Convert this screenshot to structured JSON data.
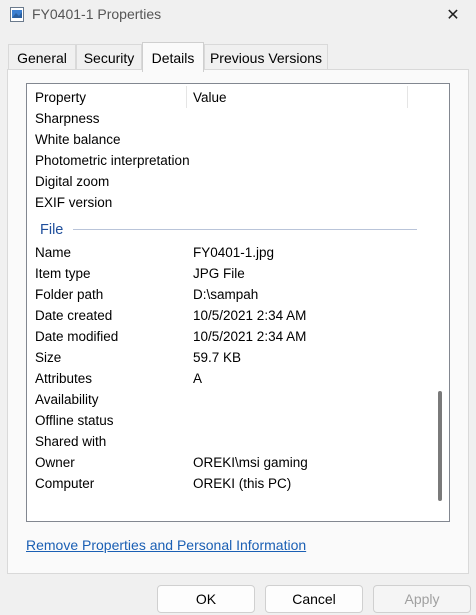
{
  "window": {
    "title": "FY0401-1 Properties",
    "close_icon": "✕"
  },
  "tabs": [
    {
      "label": "General"
    },
    {
      "label": "Security"
    },
    {
      "label": "Details"
    },
    {
      "label": "Previous Versions"
    }
  ],
  "active_tab": "Details",
  "details": {
    "column_property": "Property",
    "column_value": "Value",
    "image_rows": [
      {
        "name": "Sharpness",
        "value": ""
      },
      {
        "name": "White balance",
        "value": ""
      },
      {
        "name": "Photometric interpretation",
        "value": ""
      },
      {
        "name": "Digital zoom",
        "value": ""
      },
      {
        "name": "EXIF version",
        "value": ""
      }
    ],
    "file_group_label": "File",
    "file_rows": [
      {
        "name": "Name",
        "value": "FY0401-1.jpg"
      },
      {
        "name": "Item type",
        "value": "JPG File"
      },
      {
        "name": "Folder path",
        "value": "D:\\sampah"
      },
      {
        "name": "Date created",
        "value": "10/5/2021 2:34 AM"
      },
      {
        "name": "Date modified",
        "value": "10/5/2021 2:34 AM"
      },
      {
        "name": "Size",
        "value": "59.7 KB"
      },
      {
        "name": "Attributes",
        "value": "A"
      },
      {
        "name": "Availability",
        "value": ""
      },
      {
        "name": "Offline status",
        "value": ""
      },
      {
        "name": "Shared with",
        "value": ""
      },
      {
        "name": "Owner",
        "value": "OREKI\\msi gaming"
      },
      {
        "name": "Computer",
        "value": "OREKI (this PC)"
      }
    ]
  },
  "remove_link": "Remove Properties and Personal Information",
  "buttons": {
    "ok": "OK",
    "cancel": "Cancel",
    "apply": "Apply"
  }
}
